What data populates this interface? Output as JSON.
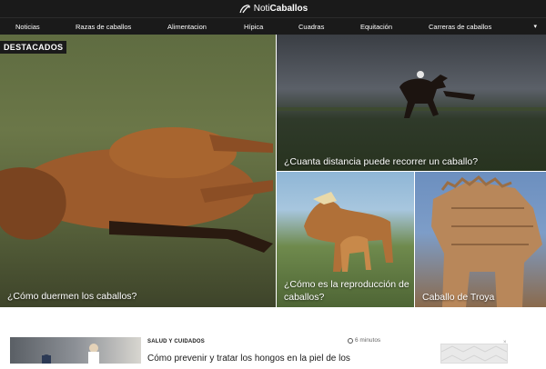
{
  "brand": {
    "prefix": "Noti",
    "name": "Caballos"
  },
  "nav": {
    "items": [
      "Noticias",
      "Razas de caballos",
      "Alimentacion",
      "Hípica",
      "Cuadras",
      "Equitación",
      "Carreras de caballos"
    ],
    "more": "▾"
  },
  "hero": {
    "badge": "DESTACADOS",
    "main": {
      "title": "¿Cómo duermen los caballos?"
    },
    "top_right": {
      "title": "¿Cuanta distancia puede recorrer un caballo?"
    },
    "bottom_middle": {
      "title": "¿Cómo es la reproducción de caballos?"
    },
    "bottom_right": {
      "title": "Caballo de Troya"
    }
  },
  "article": {
    "category": "SALUD Y CUIDADOS",
    "read_time": "6 minutos",
    "title": "Cómo prevenir y tratar los hongos en la piel de los"
  },
  "ad": {
    "close": "×"
  }
}
